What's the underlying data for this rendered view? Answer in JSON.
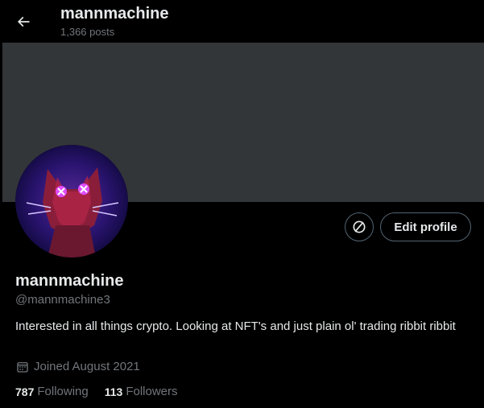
{
  "header": {
    "back_icon": "arrow-left-icon",
    "title": "mannmachine",
    "post_count": "1,366 posts"
  },
  "actions": {
    "verified_icon": "circle-slash-icon",
    "edit_profile_label": "Edit profile"
  },
  "profile": {
    "display_name": "mannmachine",
    "handle": "@mannmachine3",
    "bio": "Interested in all things crypto. Looking at NFT's and just plain ol' trading ribbit ribbit",
    "joined_icon": "calendar-icon",
    "joined": "Joined August 2021",
    "following_count": "787",
    "following_label": "Following",
    "followers_count": "113",
    "followers_label": "Followers"
  },
  "colors": {
    "background": "#000000",
    "banner": "#333639",
    "text_primary": "#e7e9ea",
    "text_secondary": "#71767b",
    "button_border": "#536471"
  }
}
